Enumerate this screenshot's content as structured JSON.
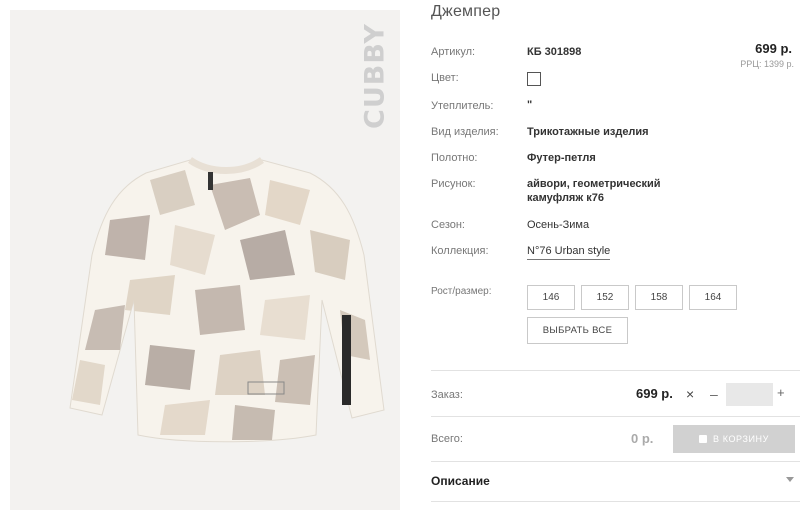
{
  "product": {
    "title": "Джемпер",
    "brand": "CUBBY",
    "price": "699 р.",
    "rrp": "РРЦ: 1399 р."
  },
  "specs": {
    "article_label": "Артикул:",
    "article_value": "КБ 301898",
    "color_label": "Цвет:",
    "insulation_label": "Утеплитель:",
    "insulation_value": "\"",
    "type_label": "Вид изделия:",
    "type_value": "Трикотажные изделия",
    "fabric_label": "Полотно:",
    "fabric_value": "Футер-петля",
    "pattern_label": "Рисунок:",
    "pattern_line1": "айвори, геометрический",
    "pattern_line2": "камуфляж к76",
    "season_label": "Сезон:",
    "season_value": "Осень-Зима",
    "collection_label": "Коллекция:",
    "collection_value": "N°76 Urban style"
  },
  "sizes": {
    "label": "Рост/размер:",
    "options": [
      "146",
      "152",
      "158",
      "164"
    ],
    "choose_all": "ВЫБРАТЬ ВСЕ"
  },
  "order": {
    "label": "Заказ:",
    "price": "699 р.",
    "times": "×",
    "minus": "–",
    "plus": "+",
    "quantity": ""
  },
  "total": {
    "label": "Всего:",
    "value": "0 р.",
    "cart_button": "В КОРЗИНУ"
  },
  "description": {
    "label": "Описание"
  },
  "icons": {
    "cart": "shopping-bag-icon",
    "expand": "chevron-down-icon"
  }
}
